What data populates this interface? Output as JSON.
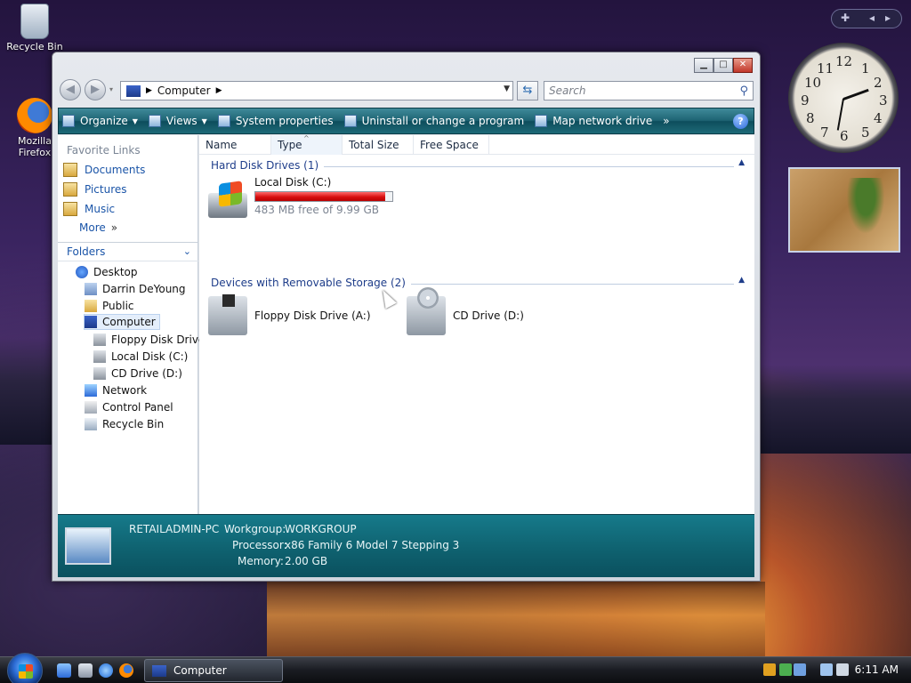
{
  "desktop": {
    "icons": [
      {
        "label": "Recycle Bin",
        "icon": "recycle-bin-icon"
      },
      {
        "label": "Mozilla Firefox",
        "icon": "firefox-icon"
      }
    ]
  },
  "clock": {
    "numbers": [
      "12",
      "1",
      "2",
      "3",
      "4",
      "5",
      "6",
      "7",
      "8",
      "9",
      "10",
      "11"
    ]
  },
  "window": {
    "address": {
      "crumbs": [
        "Computer"
      ]
    },
    "search": {
      "placeholder": "Search"
    },
    "toolbar": {
      "items": [
        {
          "label": "Organize",
          "icon": "organize-icon",
          "has_dropdown": true
        },
        {
          "label": "Views",
          "icon": "views-icon",
          "has_dropdown": true
        },
        {
          "label": "System properties",
          "icon": "system-properties-icon"
        },
        {
          "label": "Uninstall or change a program",
          "icon": "uninstall-icon"
        },
        {
          "label": "Map network drive",
          "icon": "map-drive-icon"
        }
      ],
      "overflow": "»",
      "help": "?"
    },
    "nav": {
      "favorite_links_title": "Favorite Links",
      "favorites": [
        "Documents",
        "Pictures",
        "Music",
        "More"
      ],
      "folders_title": "Folders",
      "tree": [
        {
          "label": "Desktop",
          "icon": "desktop-icon"
        },
        {
          "label": "Darrin DeYoung",
          "icon": "user-folder-icon"
        },
        {
          "label": "Public",
          "icon": "folder-icon"
        },
        {
          "label": "Computer",
          "icon": "computer-icon",
          "selected": true
        },
        {
          "label": "Floppy Disk Drive",
          "icon": "floppy-drive-icon"
        },
        {
          "label": "Local Disk (C:)",
          "icon": "hard-disk-icon"
        },
        {
          "label": "CD Drive (D:)",
          "icon": "cd-drive-icon"
        },
        {
          "label": "Network",
          "icon": "network-icon"
        },
        {
          "label": "Control Panel",
          "icon": "control-panel-icon"
        },
        {
          "label": "Recycle Bin",
          "icon": "recycle-bin-icon"
        }
      ]
    },
    "columns": [
      "Name",
      "Type",
      "Total Size",
      "Free Space"
    ],
    "groups": [
      {
        "title": "Hard Disk Drives (1)",
        "items": [
          {
            "name": "Local Disk (C:)",
            "free_text": "483 MB free of 9.99 GB",
            "used_fraction": 0.95,
            "icon": "hard-disk-icon"
          }
        ]
      },
      {
        "title": "Devices with Removable Storage (2)",
        "items": [
          {
            "name": "Floppy Disk Drive (A:)",
            "icon": "floppy-drive-icon"
          },
          {
            "name": "CD Drive (D:)",
            "icon": "cd-drive-icon"
          }
        ]
      }
    ],
    "details": {
      "computer_name": "RETAILADMIN-PC",
      "workgroup_label": "Workgroup:",
      "workgroup_value": "WORKGROUP",
      "processor_label": "Processor:",
      "processor_value": "x86 Family 6 Model 7 Stepping 3",
      "memory_label": "Memory:",
      "memory_value": "2.00 GB"
    }
  },
  "taskbar": {
    "open_window": "Computer",
    "time": "6:11 AM"
  },
  "colors": {
    "disk_bar": "#d70e0e",
    "toolbar": "#1e6473",
    "details": "#0f6270"
  }
}
